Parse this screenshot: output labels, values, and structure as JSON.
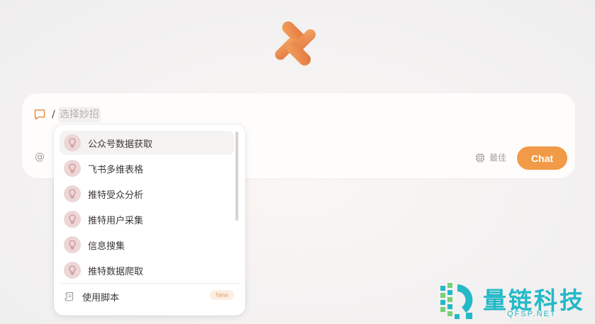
{
  "composer": {
    "slash": "/",
    "command_chip": "选择妙招",
    "at_symbol": "@",
    "model_label": "最佳",
    "send_label": "Chat"
  },
  "dropdown": {
    "items": [
      {
        "label": "公众号数据获取",
        "icon": "lightbulb-icon"
      },
      {
        "label": "飞书多维表格",
        "icon": "lightbulb-icon"
      },
      {
        "label": "推特受众分析",
        "icon": "lightbulb-icon"
      },
      {
        "label": "推特用户采集",
        "icon": "lightbulb-icon"
      },
      {
        "label": "信息搜集",
        "icon": "lightbulb-icon"
      },
      {
        "label": "推特数据爬取",
        "icon": "lightbulb-icon"
      }
    ],
    "footer_label": "使用脚本",
    "footer_badge": "New"
  },
  "watermark": {
    "name": "量链科技",
    "url": "QFSP.NET"
  },
  "colors": {
    "accent": "#f19a47",
    "bulb_bg": "#ecd6d6",
    "watermark": "#23b9c7"
  }
}
